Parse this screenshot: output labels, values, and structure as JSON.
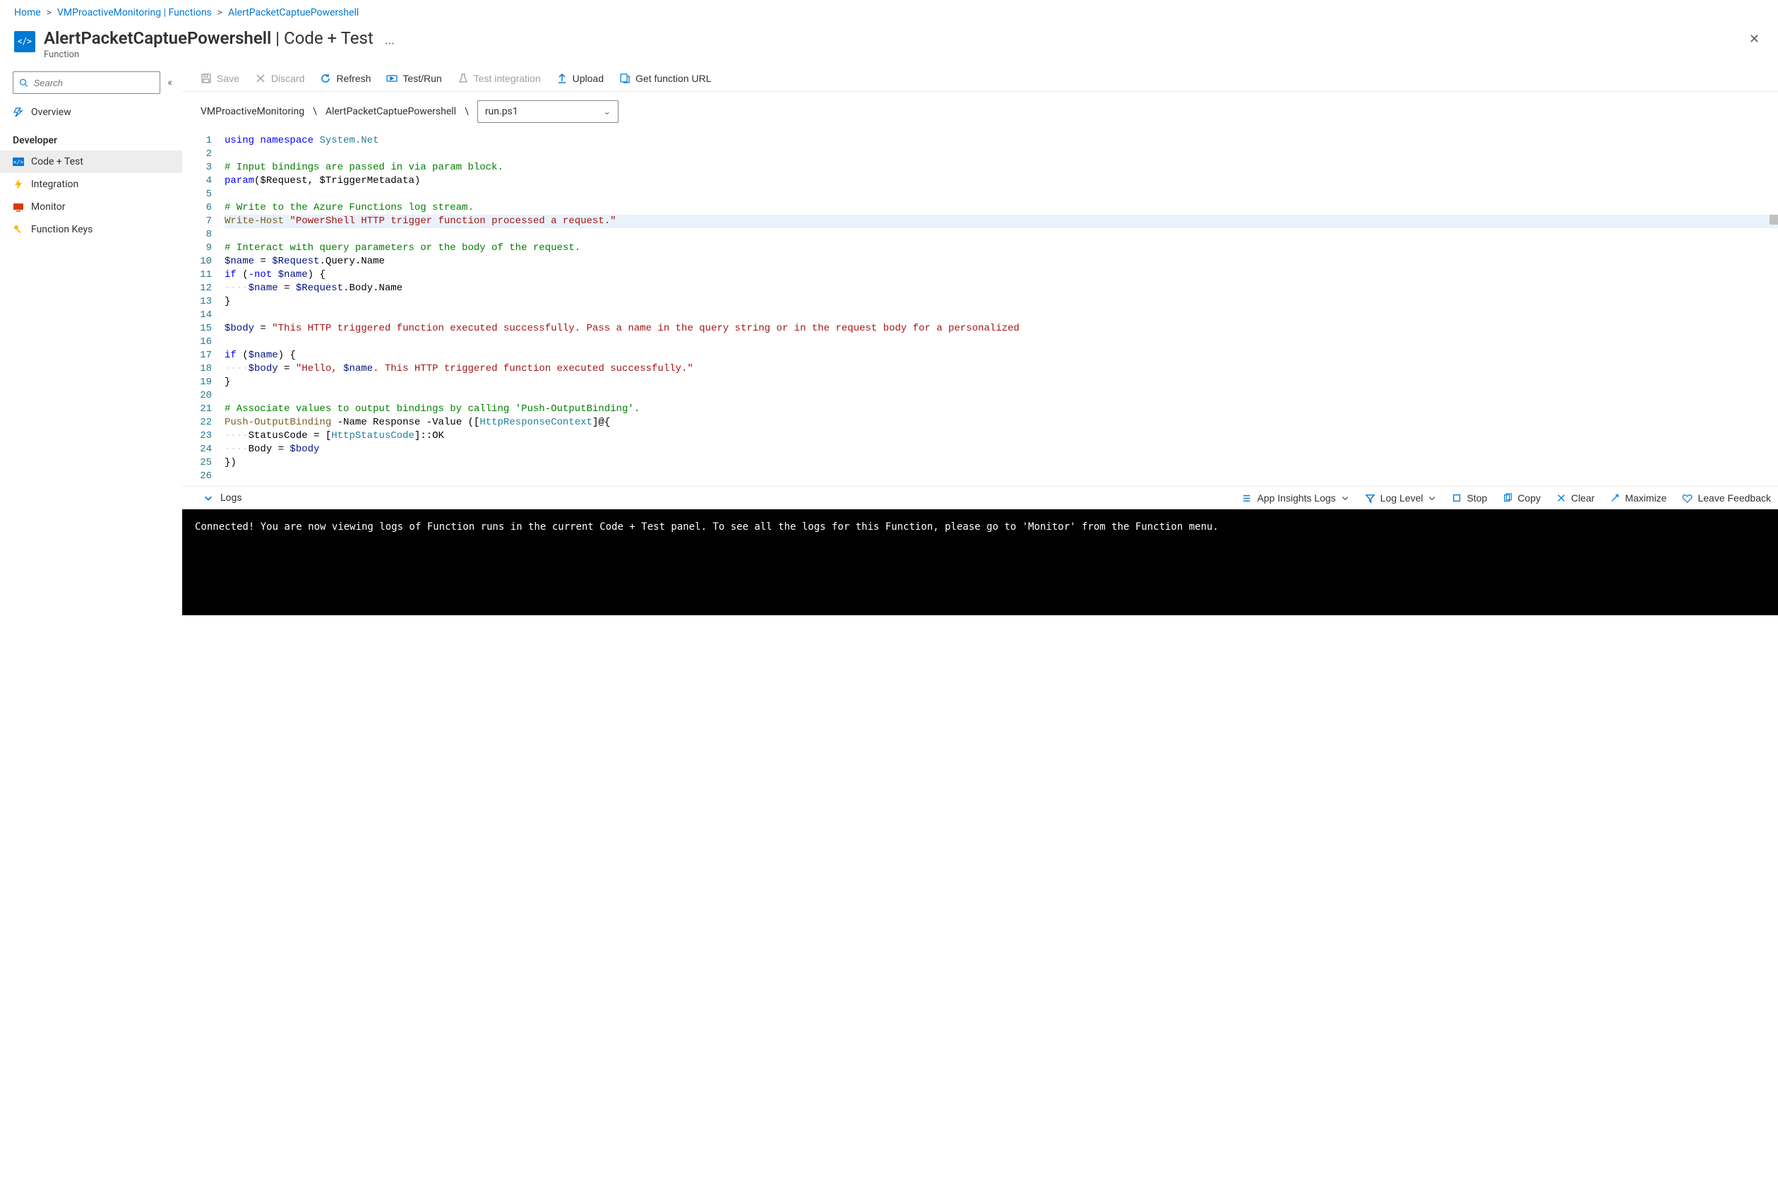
{
  "breadcrumb": {
    "home": "Home",
    "app": "VMProactiveMonitoring | Functions",
    "fn": "AlertPacketCaptuePowershell"
  },
  "header": {
    "title_main": "AlertPacketCaptuePowershell",
    "title_sep": " | ",
    "title_sub": "Code + Test",
    "subtitle": "Function",
    "ellipsis": "···",
    "close": "✕",
    "icon_glyph": "</>"
  },
  "sidebar": {
    "search_placeholder": "Search",
    "collapse_glyph": "«",
    "overview": "Overview",
    "section_label": "Developer",
    "items": [
      {
        "label": "Code + Test",
        "icon": "code-test-icon"
      },
      {
        "label": "Integration",
        "icon": "bolt-icon"
      },
      {
        "label": "Monitor",
        "icon": "monitor-icon"
      },
      {
        "label": "Function Keys",
        "icon": "key-icon"
      }
    ]
  },
  "toolbar": {
    "save": "Save",
    "discard": "Discard",
    "refresh": "Refresh",
    "test_run": "Test/Run",
    "test_integration": "Test integration",
    "upload": "Upload",
    "get_url": "Get function URL"
  },
  "path": {
    "seg1": "VMProactiveMonitoring",
    "seg2": "AlertPacketCaptuePowershell",
    "sep": "\\",
    "file": "run.ps1"
  },
  "code": {
    "lines": 26,
    "l1_kw": "using",
    "l1_ns": "namespace",
    "l1_sys": "System.Net",
    "l3": "# Input bindings are passed in via param block.",
    "l4_kw": "param",
    "l4_rest": "($Request, $TriggerMetadata)",
    "l6": "# Write to the Azure Functions log stream.",
    "l7_fn": "Write-Host ",
    "l7_str": "\"PowerShell HTTP trigger function processed a request.\"",
    "l9": "# Interact with query parameters or the body of the request.",
    "l10_var": "$name",
    "l10_eq": " = ",
    "l10_req": "$Request",
    "l10_tail": ".Query.Name",
    "l11_if": "if",
    "l11_open": " (",
    "l11_not": "-not ",
    "l11_name": "$name",
    "l11_close": ") {",
    "l12_pad": "····",
    "l12_var": "$name",
    "l12_eq": " = ",
    "l12_req": "$Request",
    "l12_tail": ".Body.Name",
    "l13": "}",
    "l15_var": "$body",
    "l15_eq": " = ",
    "l15_str": "\"This HTTP triggered function executed successfully. Pass a name in the query string or in the request body for a personalized",
    "l17_if": "if",
    "l17_open": " (",
    "l17_name": "$name",
    "l17_close": ") {",
    "l18_pad": "····",
    "l18_var": "$body",
    "l18_eq": " = ",
    "l18_s1": "\"Hello, ",
    "l18_v": "$name",
    "l18_s2": ". This HTTP triggered function executed successfully.\"",
    "l19": "}",
    "l21": "# Associate values to output bindings by calling 'Push-OutputBinding'.",
    "l22_fn": "Push-OutputBinding",
    "l22_p1": " -Name",
    "l22_v1": " Response",
    "l22_p2": " -Value",
    "l22_open": " ([",
    "l22_type": "HttpResponseContext",
    "l22_close": "]@{",
    "l23_pad": "····",
    "l23_a": "StatusCode = [",
    "l23_type": "HttpStatusCode",
    "l23_b": "]::OK",
    "l24_pad": "····",
    "l24_a": "Body = ",
    "l24_var": "$body",
    "l25": "})"
  },
  "logs": {
    "label": "Logs",
    "app_insights": "App Insights Logs",
    "log_level": "Log Level",
    "stop": "Stop",
    "copy": "Copy",
    "clear": "Clear",
    "maximize": "Maximize",
    "feedback": "Leave Feedback",
    "console_text": "Connected! You are now viewing logs of Function runs in the current Code + Test panel. To see all the logs for this Function, please go to 'Monitor' from the Function menu."
  }
}
